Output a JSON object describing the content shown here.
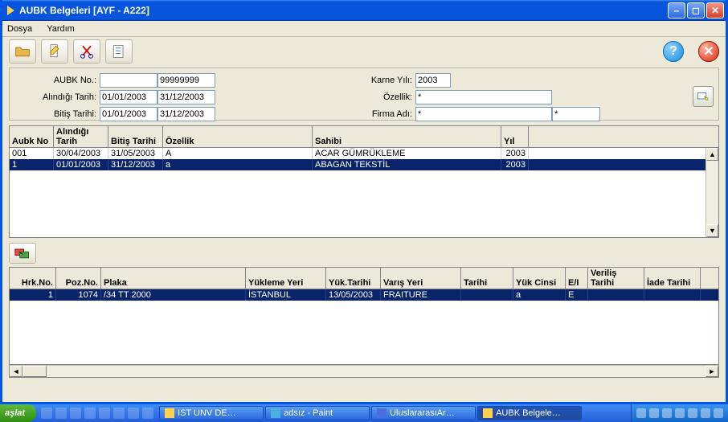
{
  "window": {
    "title": "AUBK Belgeleri [AYF - A222]"
  },
  "menu": {
    "dosya": "Dosya",
    "yardim": "Yardım"
  },
  "filters": {
    "aubk_no_lbl": "AUBK No.:",
    "aubk_no_from": "",
    "aubk_no_to": "99999999",
    "alindigi_lbl": "Alındığı Tarih:",
    "alindigi_from": "01/01/2003",
    "alindigi_to": "31/12/2003",
    "bitis_lbl": "Bitiş Tarihi:",
    "bitis_from": "01/01/2003",
    "bitis_to": "31/12/2003",
    "karne_yili_lbl": "Karne Yılı:",
    "karne_yili": "2003",
    "ozellik_lbl": "Özellik:",
    "ozellik": "*",
    "firma_adi_lbl": "Firma Adı:",
    "firma_adi_from": "*",
    "firma_adi_to": "*"
  },
  "grid1": {
    "headers": {
      "aubk_no": "Aubk No",
      "alindigi": "Alındığı Tarih",
      "bitis": "Bitiş Tarihi",
      "ozellik": "Özellik",
      "sahibi": "Sahibi",
      "yil": "Yıl"
    },
    "rows": [
      {
        "aubk_no": "001",
        "alindigi": "30/04/2003",
        "bitis": "31/05/2003",
        "ozellik": "A",
        "sahibi": "ACAR GÜMRÜKLEME",
        "yil": "2003"
      },
      {
        "aubk_no": "1",
        "alindigi": "01/01/2003",
        "bitis": "31/12/2003",
        "ozellik": "a",
        "sahibi": "ABAGAN TEKSTİL",
        "yil": "2003"
      }
    ]
  },
  "grid2": {
    "headers": {
      "hrk_no": "Hrk.No.",
      "poz_no": "Poz.No.",
      "plaka": "Plaka",
      "yukleme_yeri": "Yükleme Yeri",
      "yuk_tarihi": "Yük.Tarihi",
      "varis_yeri": "Varış Yeri",
      "tarihi": "Tarihi",
      "yuk_cinsi": "Yük Cinsi",
      "ei": "E/I",
      "verilis_tarihi": "Veriliş Tarihi",
      "iade_tarihi": "İade Tarihi"
    },
    "rows": [
      {
        "hrk_no": "1",
        "poz_no": "1074",
        "plaka": "/34 TT 2000",
        "yukleme_yeri": "İSTANBUL",
        "yuk_tarihi": "13/05/2003",
        "varis_yeri": "FRAITURE",
        "tarihi": "",
        "yuk_cinsi": "a",
        "ei": "E",
        "verilis_tarihi": "",
        "iade_tarihi": ""
      }
    ]
  },
  "taskbar": {
    "start": "aşlat",
    "items": [
      "IST UNV DE…",
      "adsız - Paint",
      "UluslararasıAr…",
      "AUBK Belgele…"
    ]
  }
}
